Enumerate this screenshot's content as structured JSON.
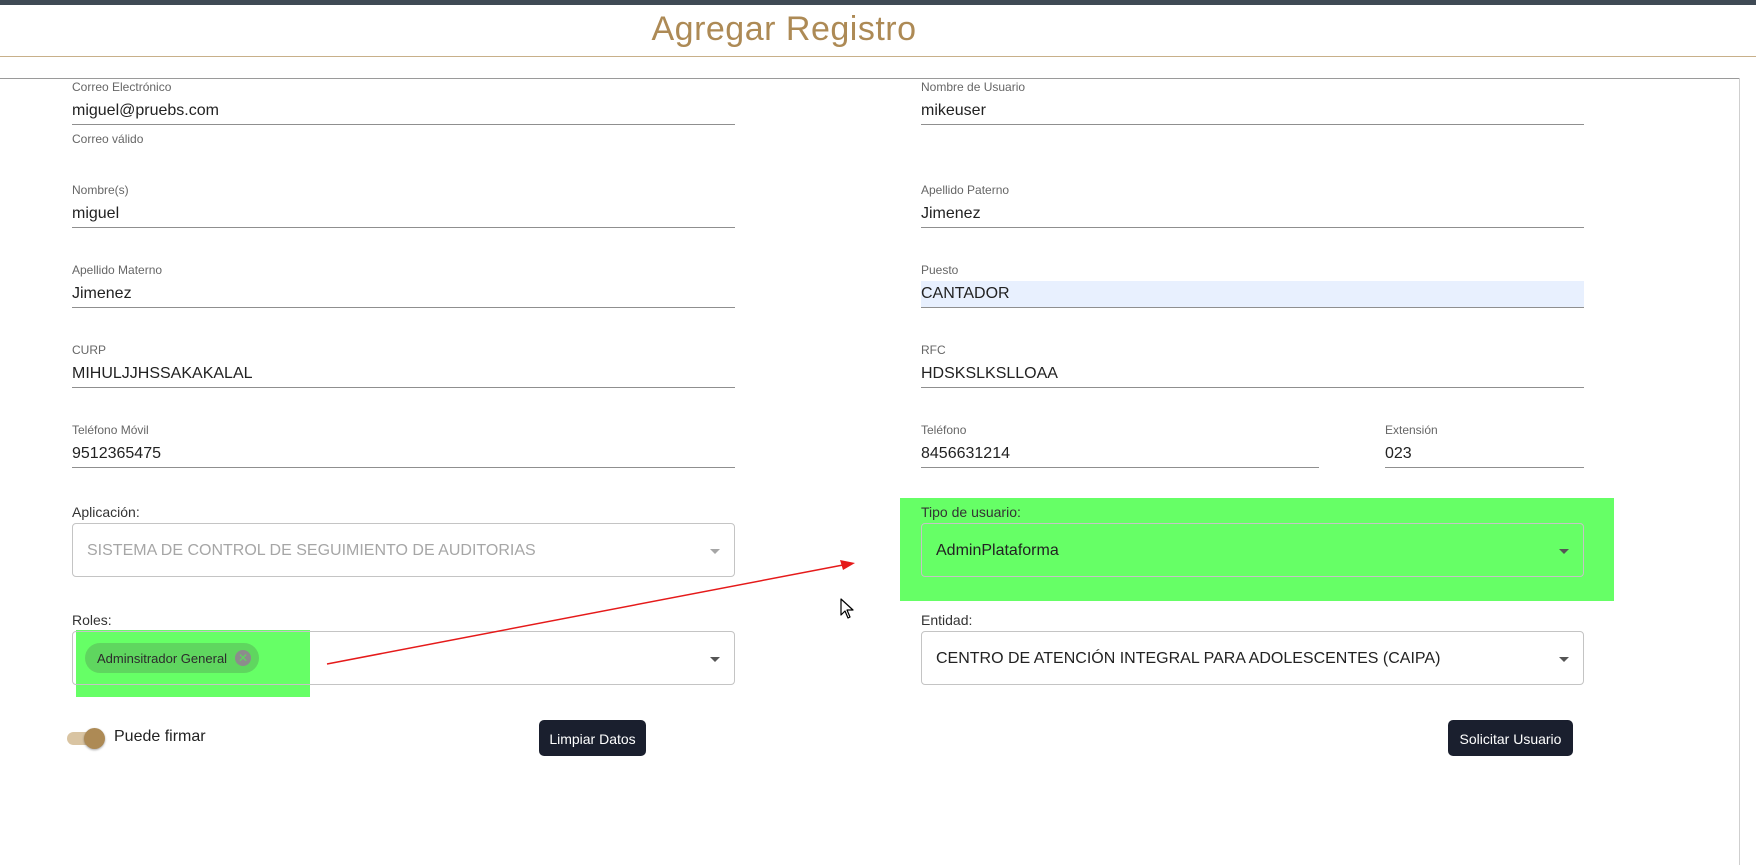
{
  "page": {
    "title": "Agregar Registro"
  },
  "form": {
    "email": {
      "label": "Correo Electrónico",
      "value": "miguel@pruebs.com",
      "helper": "Correo válido"
    },
    "username": {
      "label": "Nombre de Usuario",
      "value": "mikeuser"
    },
    "first_name": {
      "label": "Nombre(s)",
      "value": "miguel"
    },
    "last_name_paternal": {
      "label": "Apellido Paterno",
      "value": "Jimenez"
    },
    "last_name_maternal": {
      "label": "Apellido Materno",
      "value": "Jimenez"
    },
    "position": {
      "label": "Puesto",
      "value": "CANTADOR"
    },
    "curp": {
      "label": "CURP",
      "value": "MIHULJJHSSAKAKALAL"
    },
    "rfc": {
      "label": "RFC",
      "value": "HDSKSLKSLLOAA"
    },
    "mobile": {
      "label": "Teléfono Móvil",
      "value": "9512365475"
    },
    "phone": {
      "label": "Teléfono",
      "value": "8456631214"
    },
    "extension": {
      "label": "Extensión",
      "value": "023"
    },
    "application": {
      "label": "Aplicación:",
      "value": "SISTEMA DE CONTROL DE SEGUIMIENTO DE AUDITORIAS"
    },
    "user_type": {
      "label": "Tipo de usuario:",
      "value": "AdminPlataforma"
    },
    "roles": {
      "label": "Roles:",
      "chips": [
        "Adminsitrador General"
      ]
    },
    "entity": {
      "label": "Entidad:",
      "value": "CENTRO DE ATENCIÓN INTEGRAL PARA ADOLESCENTES (CAIPA)"
    },
    "can_sign": {
      "label": "Puede firmar",
      "checked": true
    }
  },
  "actions": {
    "clear_label": "Limpiar Datos",
    "submit_label": "Solicitar Usuario"
  },
  "colors": {
    "accent": "#ad8a55",
    "highlight": "#66ff66",
    "annotation_arrow": "#e51a1a",
    "button_bg": "#1a1f2e"
  }
}
